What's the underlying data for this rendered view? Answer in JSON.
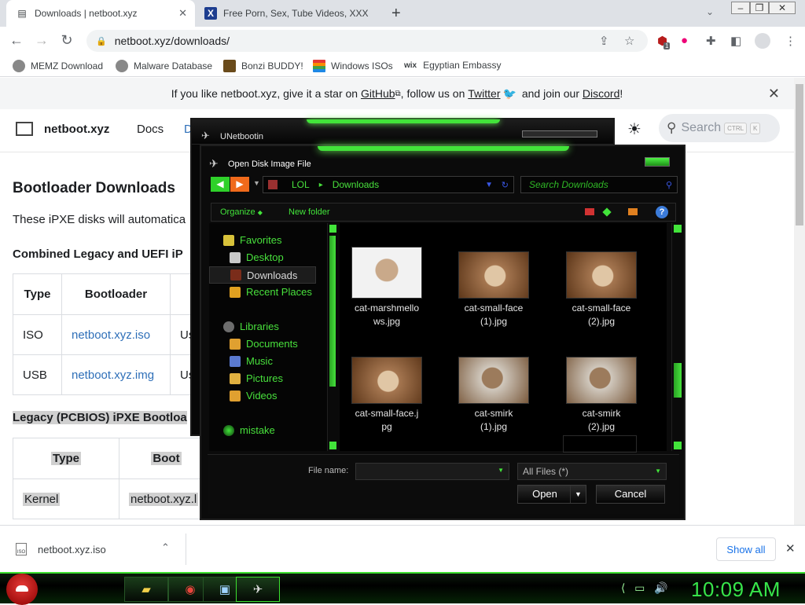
{
  "browser": {
    "tabs": [
      {
        "title": "Downloads | netboot.xyz",
        "active": true
      },
      {
        "title": "Free Porn, Sex, Tube Videos, XXX",
        "active": false
      }
    ],
    "url": "netboot.xyz/downloads/",
    "extension_badge": "1",
    "bookmarks": [
      "MEMZ Download",
      "Malware Database",
      "Bonzi BUDDY!",
      "Windows ISOs",
      "Egyptian Embassy"
    ],
    "bookmark_prefix": "wix"
  },
  "site": {
    "banner": {
      "prefix": "If you like netboot.xyz, give it a star on ",
      "github": "GitHub",
      "mid1": ", follow us on ",
      "twitter": "Twitter",
      "mid2": " and join our ",
      "discord": "Discord",
      "suffix": "!"
    },
    "name": "netboot.xyz",
    "nav_docs": "Docs",
    "nav_partial": "D",
    "search_placeholder": "Search",
    "search_keys": [
      "CTRL",
      "K"
    ],
    "heading": "Bootloader Downloads",
    "intro": "These iPXE disks will automatica",
    "combined_heading": "Combined Legacy and UEFI iP",
    "table1": {
      "headers": [
        "Type",
        "Bootloader",
        ""
      ],
      "rows": [
        [
          "ISO",
          "netboot.xyz.iso",
          "Us"
        ],
        [
          "USB",
          "netboot.xyz.img",
          "Us"
        ]
      ]
    },
    "legacy_heading": "Legacy (PCBIOS) iPXE Bootloa",
    "table2": {
      "headers": [
        "Type",
        "Boot"
      ],
      "rows": [
        [
          "Kernel",
          "netboot.xyz.l"
        ]
      ]
    }
  },
  "downloads": {
    "item": "netboot.xyz.iso",
    "file_icon_text": "ISO",
    "show_all": "Show all"
  },
  "unetbootin": {
    "title": "UNetbootin"
  },
  "dialog": {
    "title": "Open Disk Image File",
    "breadcrumb": [
      "LOL",
      "Downloads"
    ],
    "search_placeholder": "Search Downloads",
    "organize": "Organize",
    "new_folder": "New folder",
    "nav": {
      "favorites": "Favorites",
      "desktop": "Desktop",
      "downloads": "Downloads",
      "recent": "Recent Places",
      "libraries": "Libraries",
      "documents": "Documents",
      "music": "Music",
      "pictures": "Pictures",
      "videos": "Videos",
      "mistake": "mistake"
    },
    "files": [
      {
        "name_line1": "cat-marshmello",
        "name_line2": "ws.jpg",
        "thumb": "white"
      },
      {
        "name_line1": "cat-small-face",
        "name_line2": "(1).jpg",
        "thumb": "brown"
      },
      {
        "name_line1": "cat-small-face",
        "name_line2": "(2).jpg",
        "thumb": "brown"
      },
      {
        "name_line1": "cat-small-face.j",
        "name_line2": "pg",
        "thumb": "brown"
      },
      {
        "name_line1": "cat-smirk",
        "name_line2": "(1).jpg",
        "thumb": "smirk"
      },
      {
        "name_line1": "cat-smirk",
        "name_line2": "(2).jpg",
        "thumb": "smirk"
      }
    ],
    "file_name_label": "File name:",
    "file_name_value": "",
    "file_type": "All Files  (*)",
    "open": "Open",
    "cancel": "Cancel"
  },
  "taskbar": {
    "clock": "10:09 AM"
  },
  "colors": {
    "accent_green": "#42e43a",
    "link_blue": "#2e6fb8",
    "chrome_blue": "#1a73e8"
  }
}
